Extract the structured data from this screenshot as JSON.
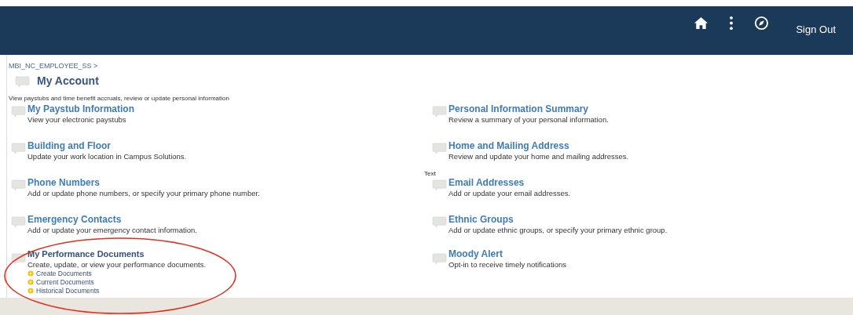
{
  "header": {
    "actions": [
      {
        "kind": "home"
      },
      {
        "kind": "more"
      },
      {
        "kind": "compass"
      },
      {
        "kind": "text",
        "label": "Sign Out"
      }
    ]
  },
  "breadcrumb": "MBI_NC_EMPLOYEE_SS >",
  "section": {
    "title": "My Account",
    "description": "View paystubs and time benefit accruals, review or update personal information"
  },
  "left_items": [
    {
      "title": "My Paystub Information",
      "description": "View your electronic paystubs"
    },
    {
      "title": "Building and Floor",
      "description": "Update your work location in Campus Solutions."
    },
    {
      "title": "Phone Numbers",
      "description": "Add or update phone numbers, or specify your primary phone number."
    },
    {
      "title": "Emergency Contacts",
      "description": "Add or update your emergency contact information."
    },
    {
      "title": "My Performance Documents",
      "description": "Create, update, or view your performance documents.",
      "links": [
        "Create Documents",
        "Current Documents",
        "Historical Documents"
      ]
    }
  ],
  "right_items": [
    {
      "title": "Personal Information Summary",
      "description": "Review a summary of your personal information."
    },
    {
      "title": "Home and Mailing Address",
      "description": "Review and update your home and mailing addresses.",
      "note": "Text"
    },
    {
      "title": "Email Addresses",
      "description": "Add or update your email addresses."
    },
    {
      "title": "Ethnic Groups",
      "description": "Add or update ethnic groups, or specify your primary ethnic group."
    },
    {
      "title": "Moody Alert",
      "description": "Opt-in to receive timely notifications"
    }
  ]
}
